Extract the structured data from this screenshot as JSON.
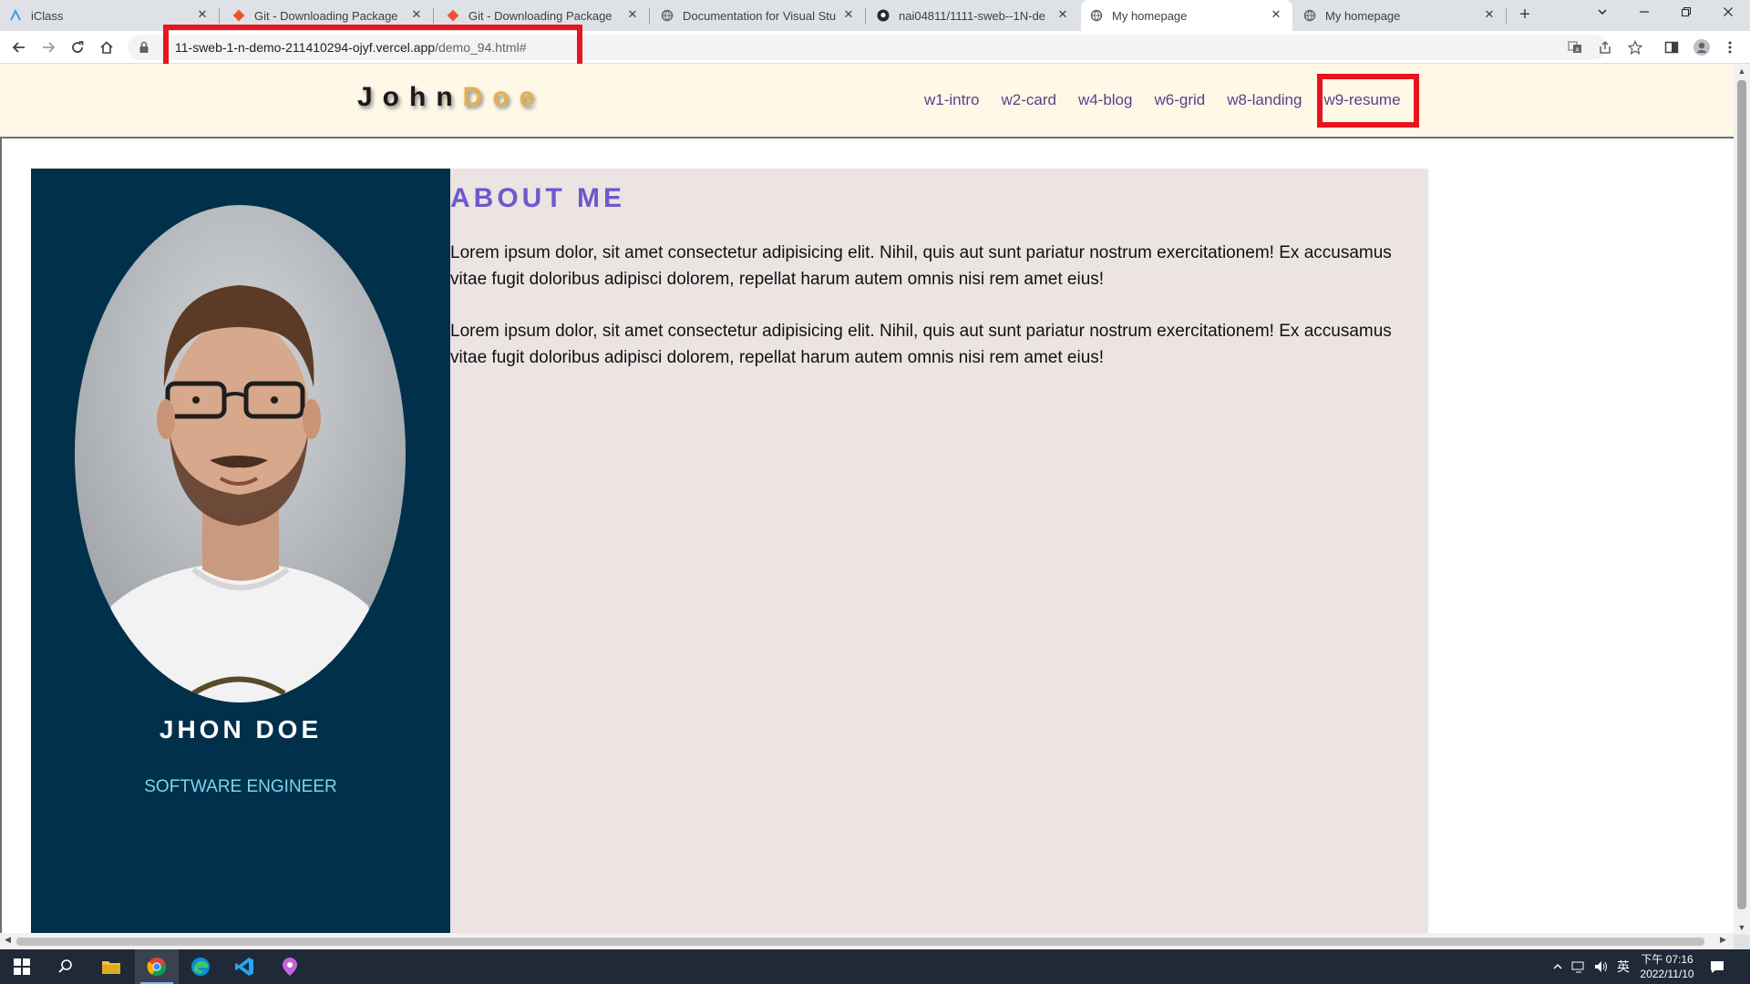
{
  "browser": {
    "tabs": [
      {
        "title": "iClass",
        "active": false
      },
      {
        "title": "Git - Downloading Package",
        "active": false
      },
      {
        "title": "Git - Downloading Package",
        "active": false
      },
      {
        "title": "Documentation for Visual Stu",
        "active": false
      },
      {
        "title": "nai04811/1111-sweb--1N-de",
        "active": false
      },
      {
        "title": "My homepage",
        "active": true
      },
      {
        "title": "My homepage",
        "active": false
      }
    ],
    "url_host": "11-sweb-1-n-demo-211410294-ojyf.vercel.app",
    "url_path": "/demo_94.html#"
  },
  "site": {
    "logo_main": "John",
    "logo_accent": "Doe",
    "nav": [
      "w1-intro",
      "w2-card",
      "w4-blog",
      "w6-grid",
      "w8-landing",
      "w9-resume"
    ],
    "accent_color": "#e2b04c",
    "nav_color": "#5a3f8c"
  },
  "profile": {
    "name": "JHON DOE",
    "role": "SOFTWARE ENGINEER",
    "card_color": "#00304a"
  },
  "about": {
    "heading": "ABOUT ME",
    "paragraphs": [
      "Lorem ipsum dolor, sit amet consectetur adipisicing elit. Nihil, quis aut sunt pariatur nostrum exercitationem! Ex accusamus vitae fugit doloribus adipisci dolorem, repellat harum autem omnis nisi rem amet eius!",
      "Lorem ipsum dolor, sit amet consectetur adipisicing elit. Nihil, quis aut sunt pariatur nostrum exercitationem! Ex accusamus vitae fugit doloribus adipisci dolorem, repellat harum autem omnis nisi rem amet eius!"
    ],
    "heading_color": "#6a5acd",
    "bg_color": "#ece3e3"
  },
  "annotations": {
    "highlight_color": "#e8141f",
    "highlighted": [
      "address-bar",
      "nav-link-w9-resume"
    ]
  },
  "taskbar": {
    "apps": [
      "windows-start-icon",
      "search-icon",
      "file-explorer-icon",
      "chrome-icon",
      "edge-icon",
      "vscode-icon",
      "maps-pin-icon"
    ],
    "ime": "英",
    "time": "下午 07:16",
    "date": "2022/11/10"
  }
}
